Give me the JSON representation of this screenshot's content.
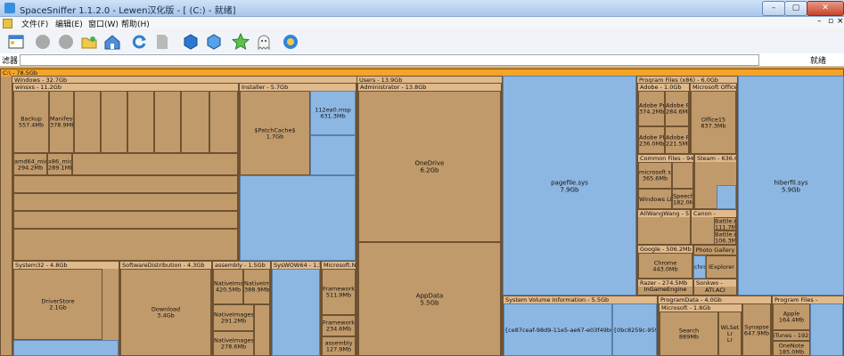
{
  "window": {
    "title": "SpaceSniffer 1.1.2.0 - Lewen汉化版 - [ (C:) - 就绪]"
  },
  "menu": [
    "文件(F)",
    "编辑(E)",
    "窗口(W)",
    "帮助(H)"
  ],
  "filter": {
    "label": "滤器",
    "status": "就绪"
  },
  "map": {
    "root": "C:\\ - 78.5Gb",
    "windows": "Windows - 32.7Gb",
    "winsxs": "winsxs - 11.2Gb",
    "installer": "Installer - 5.7Gb",
    "system32": "System32 - 4.8Gb",
    "softdist": "SoftwareDistribution - 4.3Gb",
    "assembly": "assembly - 1.5Gb",
    "syswow": "SysWOW64 - 1.3Gb",
    "dotnet": "Microsoft.NE",
    "users": "Users - 13.9Gb",
    "admin": "Administrator - 13.8Gb",
    "onedrive": [
      "OneDrive",
      "6.2Gb"
    ],
    "appdata": [
      "AppData",
      "5.5Gb"
    ],
    "pagefile": [
      "pagefile.sys",
      "7.9Gb"
    ],
    "hiberfil": [
      "hiberfil.sys",
      "5.9Gb"
    ],
    "pfx86": "Program Files (x86) - 6.0Gb",
    "adobe": "Adobe - 1.0Gb",
    "msoffice": "Microsoft Office -",
    "office15": [
      "Office15",
      "837.3Mb"
    ],
    "commonfiles": "Common Files - 948.5M",
    "steam": "Steam - 636.6M",
    "alwang": "AliWangWang - 570.7",
    "canon": "Canon -",
    "google": "Google - 506.2Mb",
    "chrome": [
      "Chrome",
      "443.0Mb"
    ],
    "photogallery": "Photo Gallery",
    "razer": "Razer - 274.5Mb",
    "sonkwo": "Sonkwo -",
    "sysvol": "System Volume Information - 5.5Gb",
    "sysvol_file1": "{ce87ceaf-98d9-11e5-ae67-e03f49b6f0c6}{3",
    "sysvol_file2": "{0bc8259c-9595-",
    "programdata": "ProgramData - 4.0Gb",
    "msft18": "Microsoft - 1.8Gb",
    "search": [
      "Search",
      "889Mb"
    ],
    "wlsetup": [
      "WLSet",
      "Lr",
      "Lr"
    ],
    "pf": "Program Files -",
    "synapse": [
      "Synapse",
      "647.9Mb"
    ],
    "backup": [
      "Backup",
      "557.4Mb"
    ],
    "manifests": [
      "Manifests",
      "378.9Mb"
    ],
    "patchcache": [
      "$PatchCache$",
      "1.7Gb"
    ],
    "msp1": [
      "112ea0.msp",
      "631.3Mb"
    ],
    "amd64": [
      "amd64_mic",
      "294.2Mb"
    ],
    "x86mic": [
      "x86_microsoft",
      "289.1Mb"
    ],
    "driverstore": [
      "DriverStore",
      "2.1Gb"
    ],
    "download": [
      "Download",
      "3.4Gb"
    ],
    "nativeimages1": [
      "NativeIma",
      "420.5Mb"
    ],
    "nativeimages2": [
      "NativeIma",
      "388.9Mb"
    ],
    "nativeimages3": [
      "NativeImages",
      "291.2Mb"
    ],
    "nativeimages4": [
      "NativeImages",
      "278.6Mb"
    ],
    "framework1": [
      "Framework",
      "511.9Mb"
    ],
    "framework2": [
      "Framework",
      "234.6Mb"
    ],
    "assembly2": [
      "assembly",
      "127.9Mb"
    ],
    "adobepre": [
      "Adobe Pre",
      "374.2Mb"
    ],
    "adobeph": [
      "Adobe Ph",
      "236.0Mb"
    ],
    "adobe_r": [
      "Adobe Pre",
      "284.6Mb"
    ],
    "adobe_r2": [
      "Adobe Pre",
      "221.5Mb"
    ],
    "msshared": [
      "microsoft sha",
      "365.6Mb"
    ],
    "winlive": "Windows Live",
    "speech": [
      "SpeechEn",
      "182.0Mb"
    ],
    "iexplorer": "IExplorer",
    "chromo": "chro",
    "ati": "ATI.ACI",
    "ingameengine": "InGameEngine",
    "itunes": "iTunes - 192.0Mb",
    "applemb": [
      "Apple",
      "164.4Mb"
    ],
    "battle": [
      "Battle.n",
      "111.7M"
    ],
    "battle2": [
      "Battle.n",
      "106.3M"
    ],
    "office_apps": [
      "OneNote",
      "185.0Mb"
    ]
  }
}
